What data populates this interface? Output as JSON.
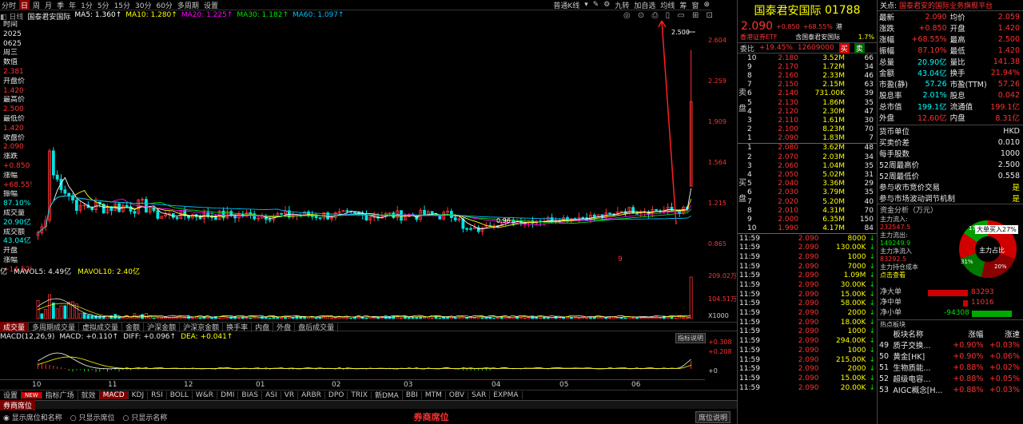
{
  "toolbar": {
    "items": [
      "分时",
      "日",
      "周",
      "月",
      "季",
      "年",
      "1分",
      "5分",
      "15分",
      "30分",
      "60分",
      "多周期",
      "设置"
    ],
    "selected": "日",
    "right_items": [
      "普通K线",
      "九转",
      "加自选",
      "均线",
      "筹",
      "窗"
    ]
  },
  "stock": {
    "code_label": "国泰君安国际",
    "name": "国泰君安国际",
    "code": "01788",
    "price": "2.090",
    "change": "+0.850",
    "change_pct": "+68.55%",
    "marker": "港",
    "broker": "香港证券ETF",
    "broker_pct": "1.7%",
    "ratio_label": "委比",
    "ratio": "+19.45%",
    "ratio_vol": "12609000",
    "buy": "买",
    "sell": "卖",
    "related_label": "关点:",
    "related": "国泰君安的国际业务旗舰平台",
    "right_header": "含国泰君安国际"
  },
  "ma": {
    "ma5": "MA5: 1.360↑",
    "ma10": "MA10: 1.280↑",
    "ma20": "MA20: 1.225↑",
    "ma30": "MA30: 1.182↑",
    "ma60": "MA60: 1.097↑"
  },
  "colors": {
    "ma5": "#ffffff",
    "ma10": "#ffff00",
    "ma20": "#ff00ff",
    "ma30": "#00e600",
    "ma60": "#00bfff"
  },
  "left_info": [
    {
      "l": "时间",
      "v": "2025",
      "c": "wht"
    },
    {
      "l": "",
      "v": "0625",
      "c": "wht"
    },
    {
      "l": "",
      "v": "周三",
      "c": "wht"
    },
    {
      "l": "数值",
      "v": "2.381",
      "c": "red"
    },
    {
      "l": "开盘价",
      "v": "1.420",
      "c": "red"
    },
    {
      "l": "最高价",
      "v": "2.500",
      "c": "red"
    },
    {
      "l": "最低价",
      "v": "1.420",
      "c": "red"
    },
    {
      "l": "收盘价",
      "v": "2.090",
      "c": "red"
    },
    {
      "l": "涨跌",
      "v": "+0.850",
      "c": "red"
    },
    {
      "l": "涨幅",
      "v": "+68.55%",
      "c": "red"
    },
    {
      "l": "振幅",
      "v": "87.10%",
      "c": "cyan"
    },
    {
      "l": "成交量",
      "v": "20.90亿",
      "c": "cyan"
    },
    {
      "l": "成交额",
      "v": "43.04亿",
      "c": "cyan"
    },
    {
      "l": "开盘",
      "v": "",
      "c": "wht"
    },
    {
      "l": "涨幅",
      "v": "+14.52%",
      "c": "red"
    }
  ],
  "price_axis": [
    "2.604",
    "2.259",
    "1.909",
    "1.564",
    "1.215",
    "0.865"
  ],
  "high_mark": "2.500",
  "low_mark": "0.96",
  "mark_9": "9",
  "vol_bar": {
    "label": "亿",
    "mavol5": "MAVOL5: 4.49亿",
    "mavol10": "MAVOL10: 2.40亿"
  },
  "vol_axis": [
    "209.02万",
    "104.51万",
    "X1000"
  ],
  "tabs1": [
    "成交量",
    "多周期成交量",
    "虚拟成交量",
    "金额",
    "沪深金额",
    "沪深京金额",
    "换手率",
    "内盘",
    "外盘",
    "盘后成交量"
  ],
  "macd": {
    "label": "MACD(12,26,9)",
    "macd": "MACD: +0.110↑",
    "diff": "DIFF: +0.096↑",
    "dea": "DEA: +0.041↑",
    "ind_btn": "指标说明",
    "axis": [
      "+0.308",
      "+0.208",
      "+0"
    ]
  },
  "months": [
    "10",
    "11",
    "12",
    "01",
    "02",
    "03",
    "04",
    "05",
    "06"
  ],
  "tabs2": [
    "设置",
    "NEW",
    "指标广场",
    "就效",
    "MACD",
    "KDJ",
    "RSI",
    "BOLL",
    "W&R",
    "DMI",
    "BIAS",
    "ASI",
    "VR",
    "ARBR",
    "DPO",
    "TRIX",
    "新DMA",
    "BBI",
    "MTM",
    "OBV",
    "SAR",
    "EXPMA"
  ],
  "bottom": {
    "btn": "券商席位",
    "opt1": "显示席位和名称",
    "opt2": "只显示席位",
    "opt3": "只显示名称",
    "center": "券商席位",
    "right": "席位说明"
  },
  "quote": [
    [
      "最新",
      "2.090",
      "均价",
      "2.059"
    ],
    [
      "涨跌",
      "+0.850",
      "开盘",
      "1.420"
    ],
    [
      "涨幅",
      "+68.55%",
      "最高",
      "2.500"
    ],
    [
      "振幅",
      "87.10%",
      "最低",
      "1.420"
    ],
    [
      "总量",
      "20.90亿",
      "量比",
      "141.38"
    ],
    [
      "金额",
      "43.04亿",
      "换手",
      "21.94%"
    ],
    [
      "市盈(静)",
      "57.26",
      "市盈(TTM)",
      "57.26"
    ],
    [
      "股息率",
      "2.01%",
      "股息",
      "0.042"
    ],
    [
      "总市值",
      "199.1亿",
      "流通值",
      "199.1亿"
    ],
    [
      "外盘",
      "12.60亿",
      "内盘",
      "8.31亿"
    ]
  ],
  "info": [
    [
      "货币单位",
      "HKD"
    ],
    [
      "买卖价差",
      "0.010"
    ],
    [
      "每手股数",
      "1000"
    ],
    [
      "52周最高价",
      "2.500"
    ],
    [
      "52周最低价",
      "0.558"
    ],
    [
      "参与收市竞价交易",
      "是"
    ],
    [
      "参与市场波动调节机制",
      "是"
    ]
  ],
  "sell_orders": [
    [
      "10",
      "2.180",
      "3.52M",
      "66"
    ],
    [
      "9",
      "2.170",
      "1.72M",
      "34"
    ],
    [
      "8",
      "2.160",
      "2.33M",
      "46"
    ],
    [
      "7",
      "2.150",
      "2.15M",
      "63"
    ],
    [
      "6",
      "2.140",
      "731.00K",
      "39"
    ],
    [
      "5",
      "2.130",
      "1.86M",
      "35"
    ],
    [
      "4",
      "2.120",
      "2.30M",
      "47"
    ],
    [
      "3",
      "2.110",
      "1.61M",
      "30"
    ],
    [
      "2",
      "2.100",
      "8.23M",
      "70"
    ],
    [
      "1",
      "2.090",
      "1.83M",
      "7"
    ]
  ],
  "buy_orders": [
    [
      "1",
      "2.080",
      "3.62M",
      "48"
    ],
    [
      "2",
      "2.070",
      "2.03M",
      "34"
    ],
    [
      "3",
      "2.060",
      "1.04M",
      "35"
    ],
    [
      "4",
      "2.050",
      "5.02M",
      "31"
    ],
    [
      "5",
      "2.040",
      "3.36M",
      "29"
    ],
    [
      "6",
      "2.030",
      "3.79M",
      "35"
    ],
    [
      "7",
      "2.020",
      "5.20M",
      "40"
    ],
    [
      "8",
      "2.010",
      "4.31M",
      "70"
    ],
    [
      "9",
      "2.000",
      "6.35M",
      "150"
    ],
    [
      "10",
      "1.990",
      "4.17M",
      "84"
    ]
  ],
  "side_labels": {
    "sell": "卖盘",
    "buy": "买盘"
  },
  "ticks": [
    [
      "11:59",
      "2.090",
      "8000",
      "↓"
    ],
    [
      "11:59",
      "2.090",
      "130.00K",
      "↓"
    ],
    [
      "11:59",
      "2.090",
      "1000",
      "↓"
    ],
    [
      "11:59",
      "2.090",
      "7000",
      "↓"
    ],
    [
      "11:59",
      "2.090",
      "1.09M",
      "↓"
    ],
    [
      "11:59",
      "2.090",
      "30.00K",
      "↓"
    ],
    [
      "11:59",
      "2.090",
      "15.00K",
      "↓"
    ],
    [
      "11:59",
      "2.090",
      "58.00K",
      "↓"
    ],
    [
      "11:59",
      "2.090",
      "2000",
      "↓"
    ],
    [
      "11:59",
      "2.090",
      "18.00K",
      "↓"
    ],
    [
      "11:59",
      "2.090",
      "1000",
      "↓"
    ],
    [
      "11:59",
      "2.090",
      "294.00K",
      "↓"
    ],
    [
      "11:59",
      "2.090",
      "1000",
      "↓"
    ],
    [
      "11:59",
      "2.090",
      "215.00K",
      "↓"
    ],
    [
      "11:59",
      "2.090",
      "2000",
      "↓"
    ],
    [
      "11:59",
      "2.090",
      "15.00K",
      "↓"
    ],
    [
      "11:59",
      "2.090",
      "20.00K",
      "↓"
    ]
  ],
  "fund": {
    "title": "资金分析（万元）",
    "in_label": "主力流入:",
    "in_val": "232547.5",
    "out_label": "主力流出:",
    "out_val": "149249.9",
    "net_label": "主力净流入",
    "net_val": "83292.5",
    "cost_label": "主力持仓成本",
    "cost_val": "点击查看",
    "tooltip": "大单买入27%",
    "center": "主力占比",
    "p17": "17%",
    "p31": "31%",
    "p20": "20%",
    "big_label": "净大单",
    "big_val": "83293",
    "mid_label": "净中单",
    "mid_val": "11016",
    "small_label": "净小单",
    "small_val": "-94308"
  },
  "sectors": {
    "title": "热点板块",
    "headers": [
      "板块名称",
      "涨幅",
      "涨速"
    ],
    "rows": [
      [
        "49",
        "质子交换...",
        "+0.90%",
        "+0.03%"
      ],
      [
        "50",
        "黄金[HK]",
        "+0.90%",
        "+0.06%"
      ],
      [
        "51",
        "生物质能...",
        "+0.88%",
        "+0.02%"
      ],
      [
        "52",
        "超级电容...",
        "+0.88%",
        "+0.05%"
      ],
      [
        "53",
        "AIGC概念[H...",
        "+0.88%",
        "+0.03%"
      ]
    ]
  },
  "chart_data": {
    "type": "candlestick",
    "title": "",
    "ylim": [
      0.865,
      2.604
    ],
    "x_ticks": [
      "10",
      "11",
      "12",
      "01",
      "02",
      "03",
      "04",
      "05",
      "06"
    ],
    "last": {
      "open": 1.42,
      "high": 2.5,
      "low": 1.42,
      "close": 2.09
    },
    "macd_axis": [
      0,
      0.208,
      0.308
    ]
  }
}
